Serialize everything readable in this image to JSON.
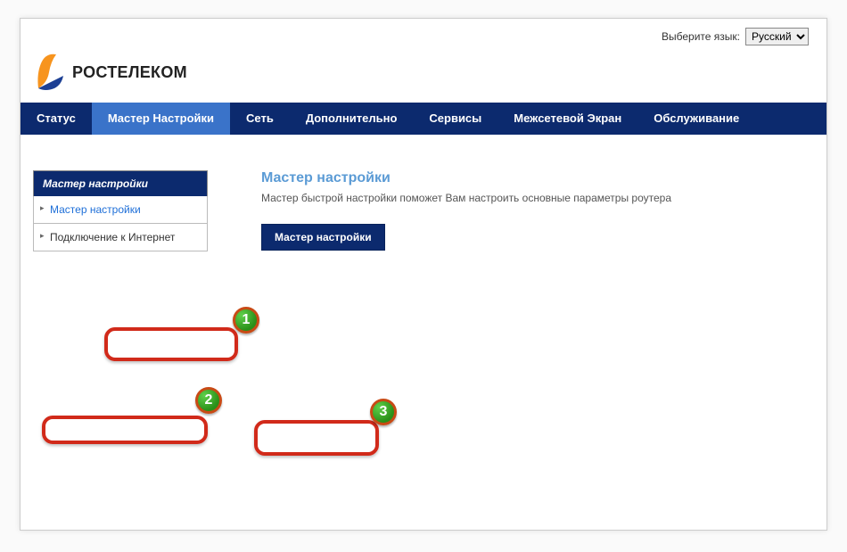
{
  "lang": {
    "label": "Выберите язык:",
    "options": [
      "Русский"
    ],
    "selected": "Русский"
  },
  "brand": {
    "name": "РОСТЕЛЕКОМ"
  },
  "nav": {
    "items": [
      {
        "label": "Статус"
      },
      {
        "label": "Мастер Настройки",
        "active": true
      },
      {
        "label": "Сеть"
      },
      {
        "label": "Дополнительно"
      },
      {
        "label": "Сервисы"
      },
      {
        "label": "Межсетевой Экран"
      },
      {
        "label": "Обслуживание"
      }
    ]
  },
  "sidebar": {
    "header": "Мастер настройки",
    "items": [
      {
        "label": "Мастер настройки",
        "active": true
      },
      {
        "label": "Подключение к Интернет"
      }
    ]
  },
  "content": {
    "title": "Мастер настройки",
    "description": "Мастер быстрой настройки поможет Вам настроить основные параметры роутера",
    "button": "Мастер настройки"
  },
  "annotations": {
    "n1": "1",
    "n2": "2",
    "n3": "3"
  }
}
